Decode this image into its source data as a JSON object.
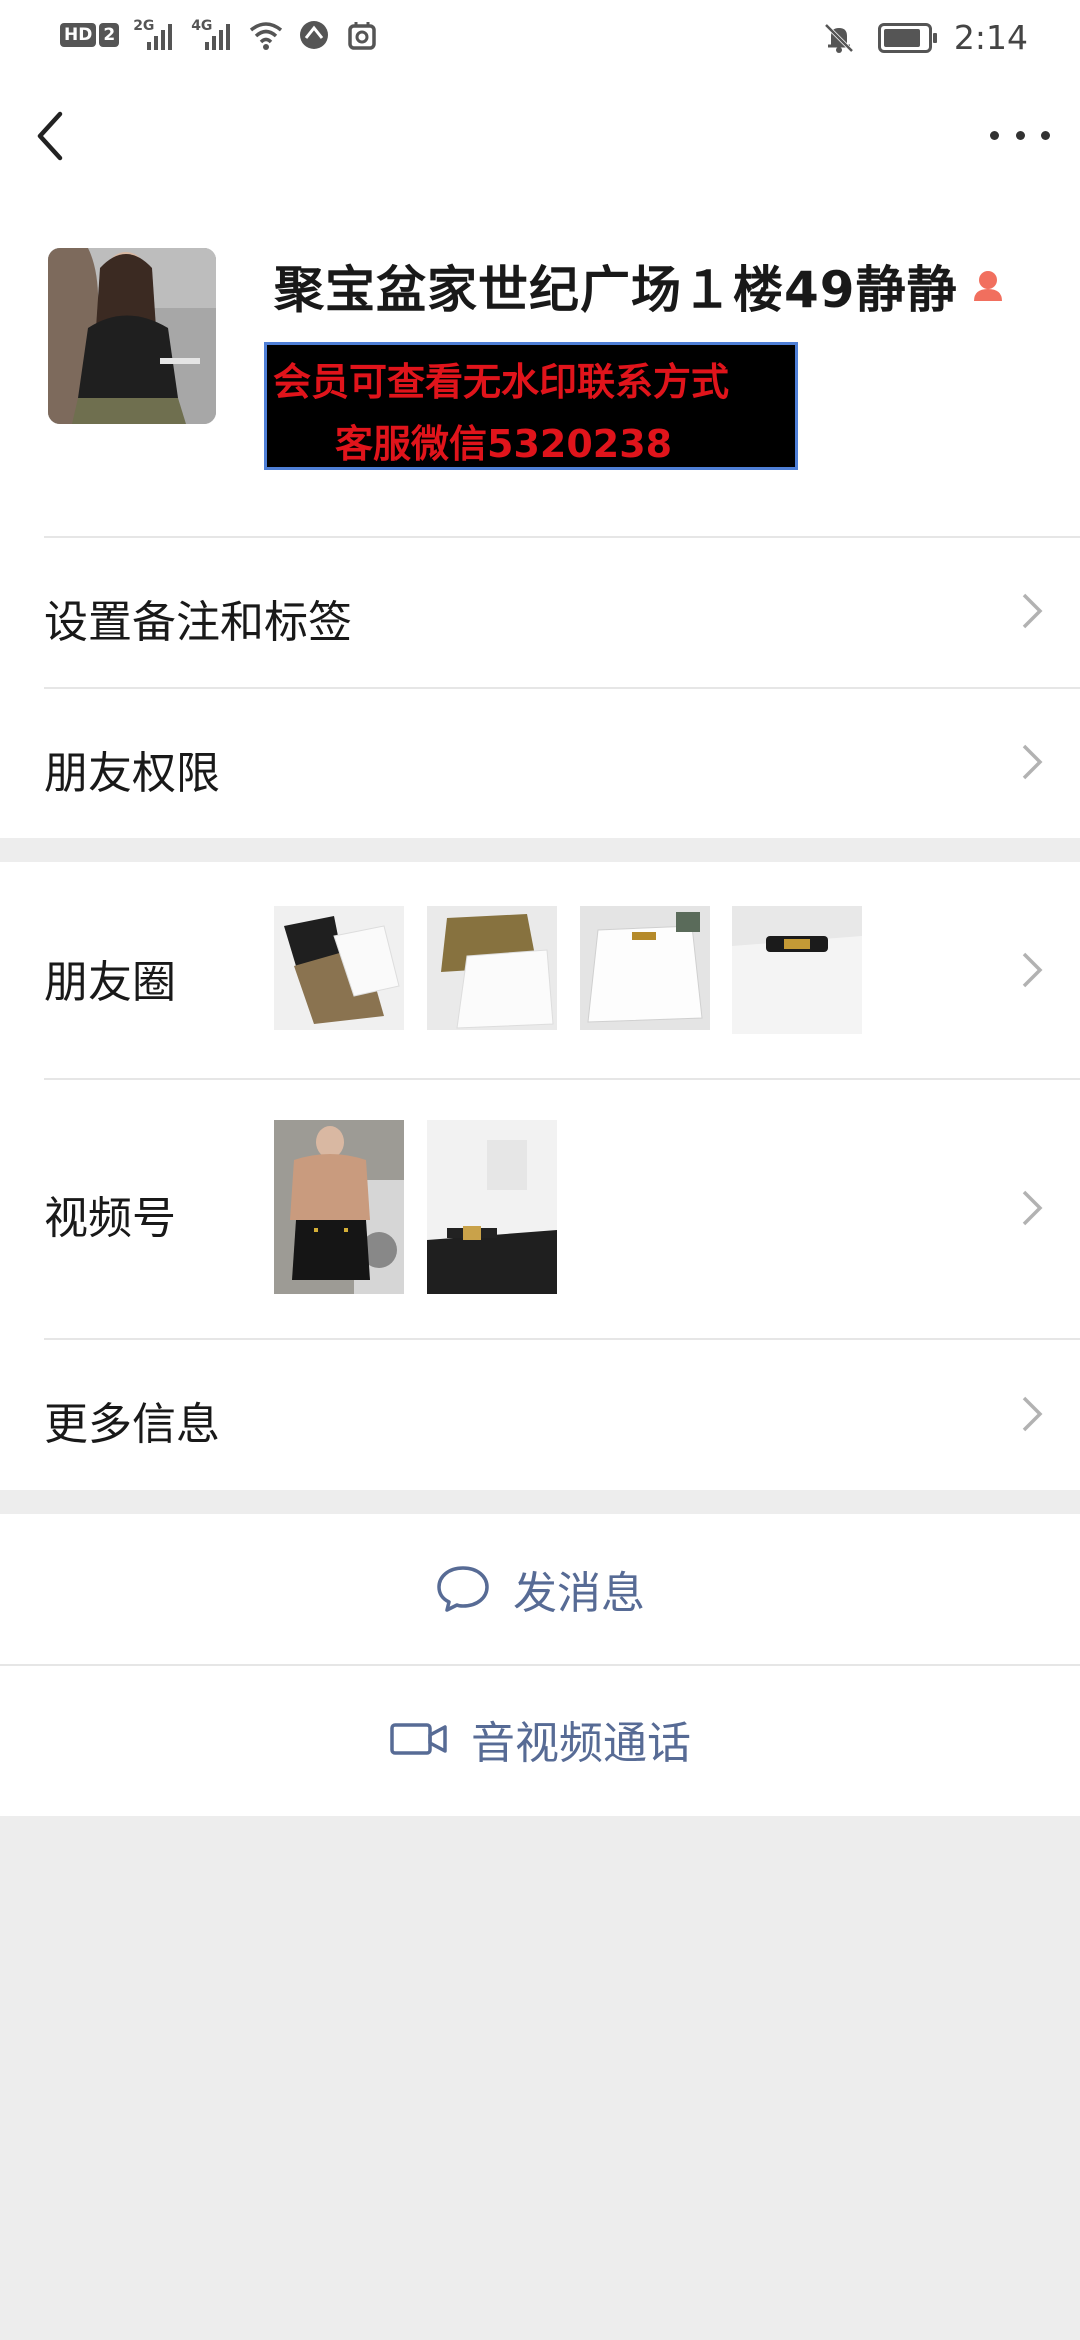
{
  "status_bar": {
    "hd_label": "HD",
    "sim_label": "2",
    "signal1_tag": "2G",
    "signal2_tag": "4G",
    "time": "2:14"
  },
  "profile": {
    "name": "聚宝盆家世纪广场１楼49静静",
    "banner_line1": "会员可查看无水印联系方式",
    "banner_line2": "客服微信5320238"
  },
  "menu": {
    "remark_label": "设置备注和标签",
    "permission_label": "朋友权限",
    "moments_label": "朋友圈",
    "channels_label": "视频号",
    "more_info_label": "更多信息"
  },
  "actions": {
    "message_label": "发消息",
    "call_label": "音视频通话"
  },
  "colors": {
    "link_blue": "#576b95",
    "banner_red": "#e0141b",
    "page_bg": "#ededed"
  }
}
